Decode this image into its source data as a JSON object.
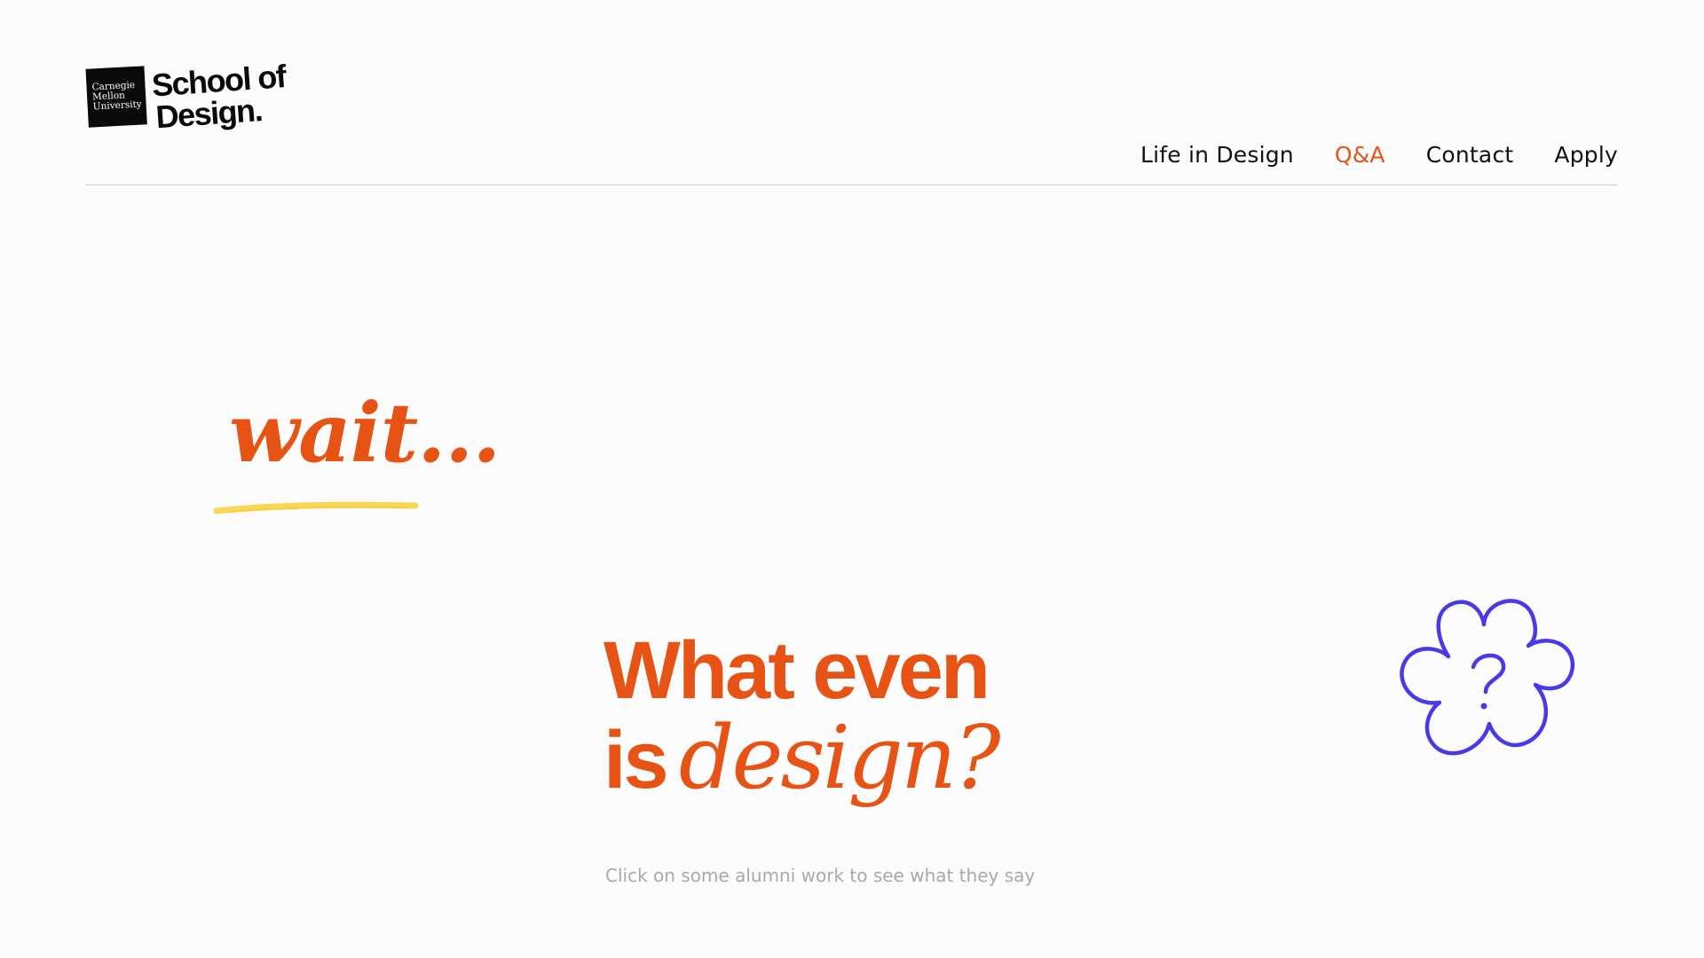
{
  "header": {
    "logo": {
      "institution_lines": [
        "Carnegie",
        "Mellon",
        "University"
      ],
      "wordmark_lines": [
        "School of",
        "Design."
      ]
    },
    "nav": [
      {
        "label": "Life in Design",
        "active": false
      },
      {
        "label": "Q&A",
        "active": true
      },
      {
        "label": "Contact",
        "active": false
      },
      {
        "label": "Apply",
        "active": false
      }
    ]
  },
  "hero": {
    "wait_text": "wait...",
    "headline_line1": "What even",
    "headline_is": "is",
    "headline_design": "design?",
    "subtext": "Click on some alumni work to see what they say",
    "doodle_icon": "flower-question-icon"
  },
  "colors": {
    "accent": "#e65314",
    "underline": "#f7d341",
    "doodle": "#4a3ae6",
    "muted_text": "#a9a9a9",
    "background": "#fcfcfc"
  }
}
